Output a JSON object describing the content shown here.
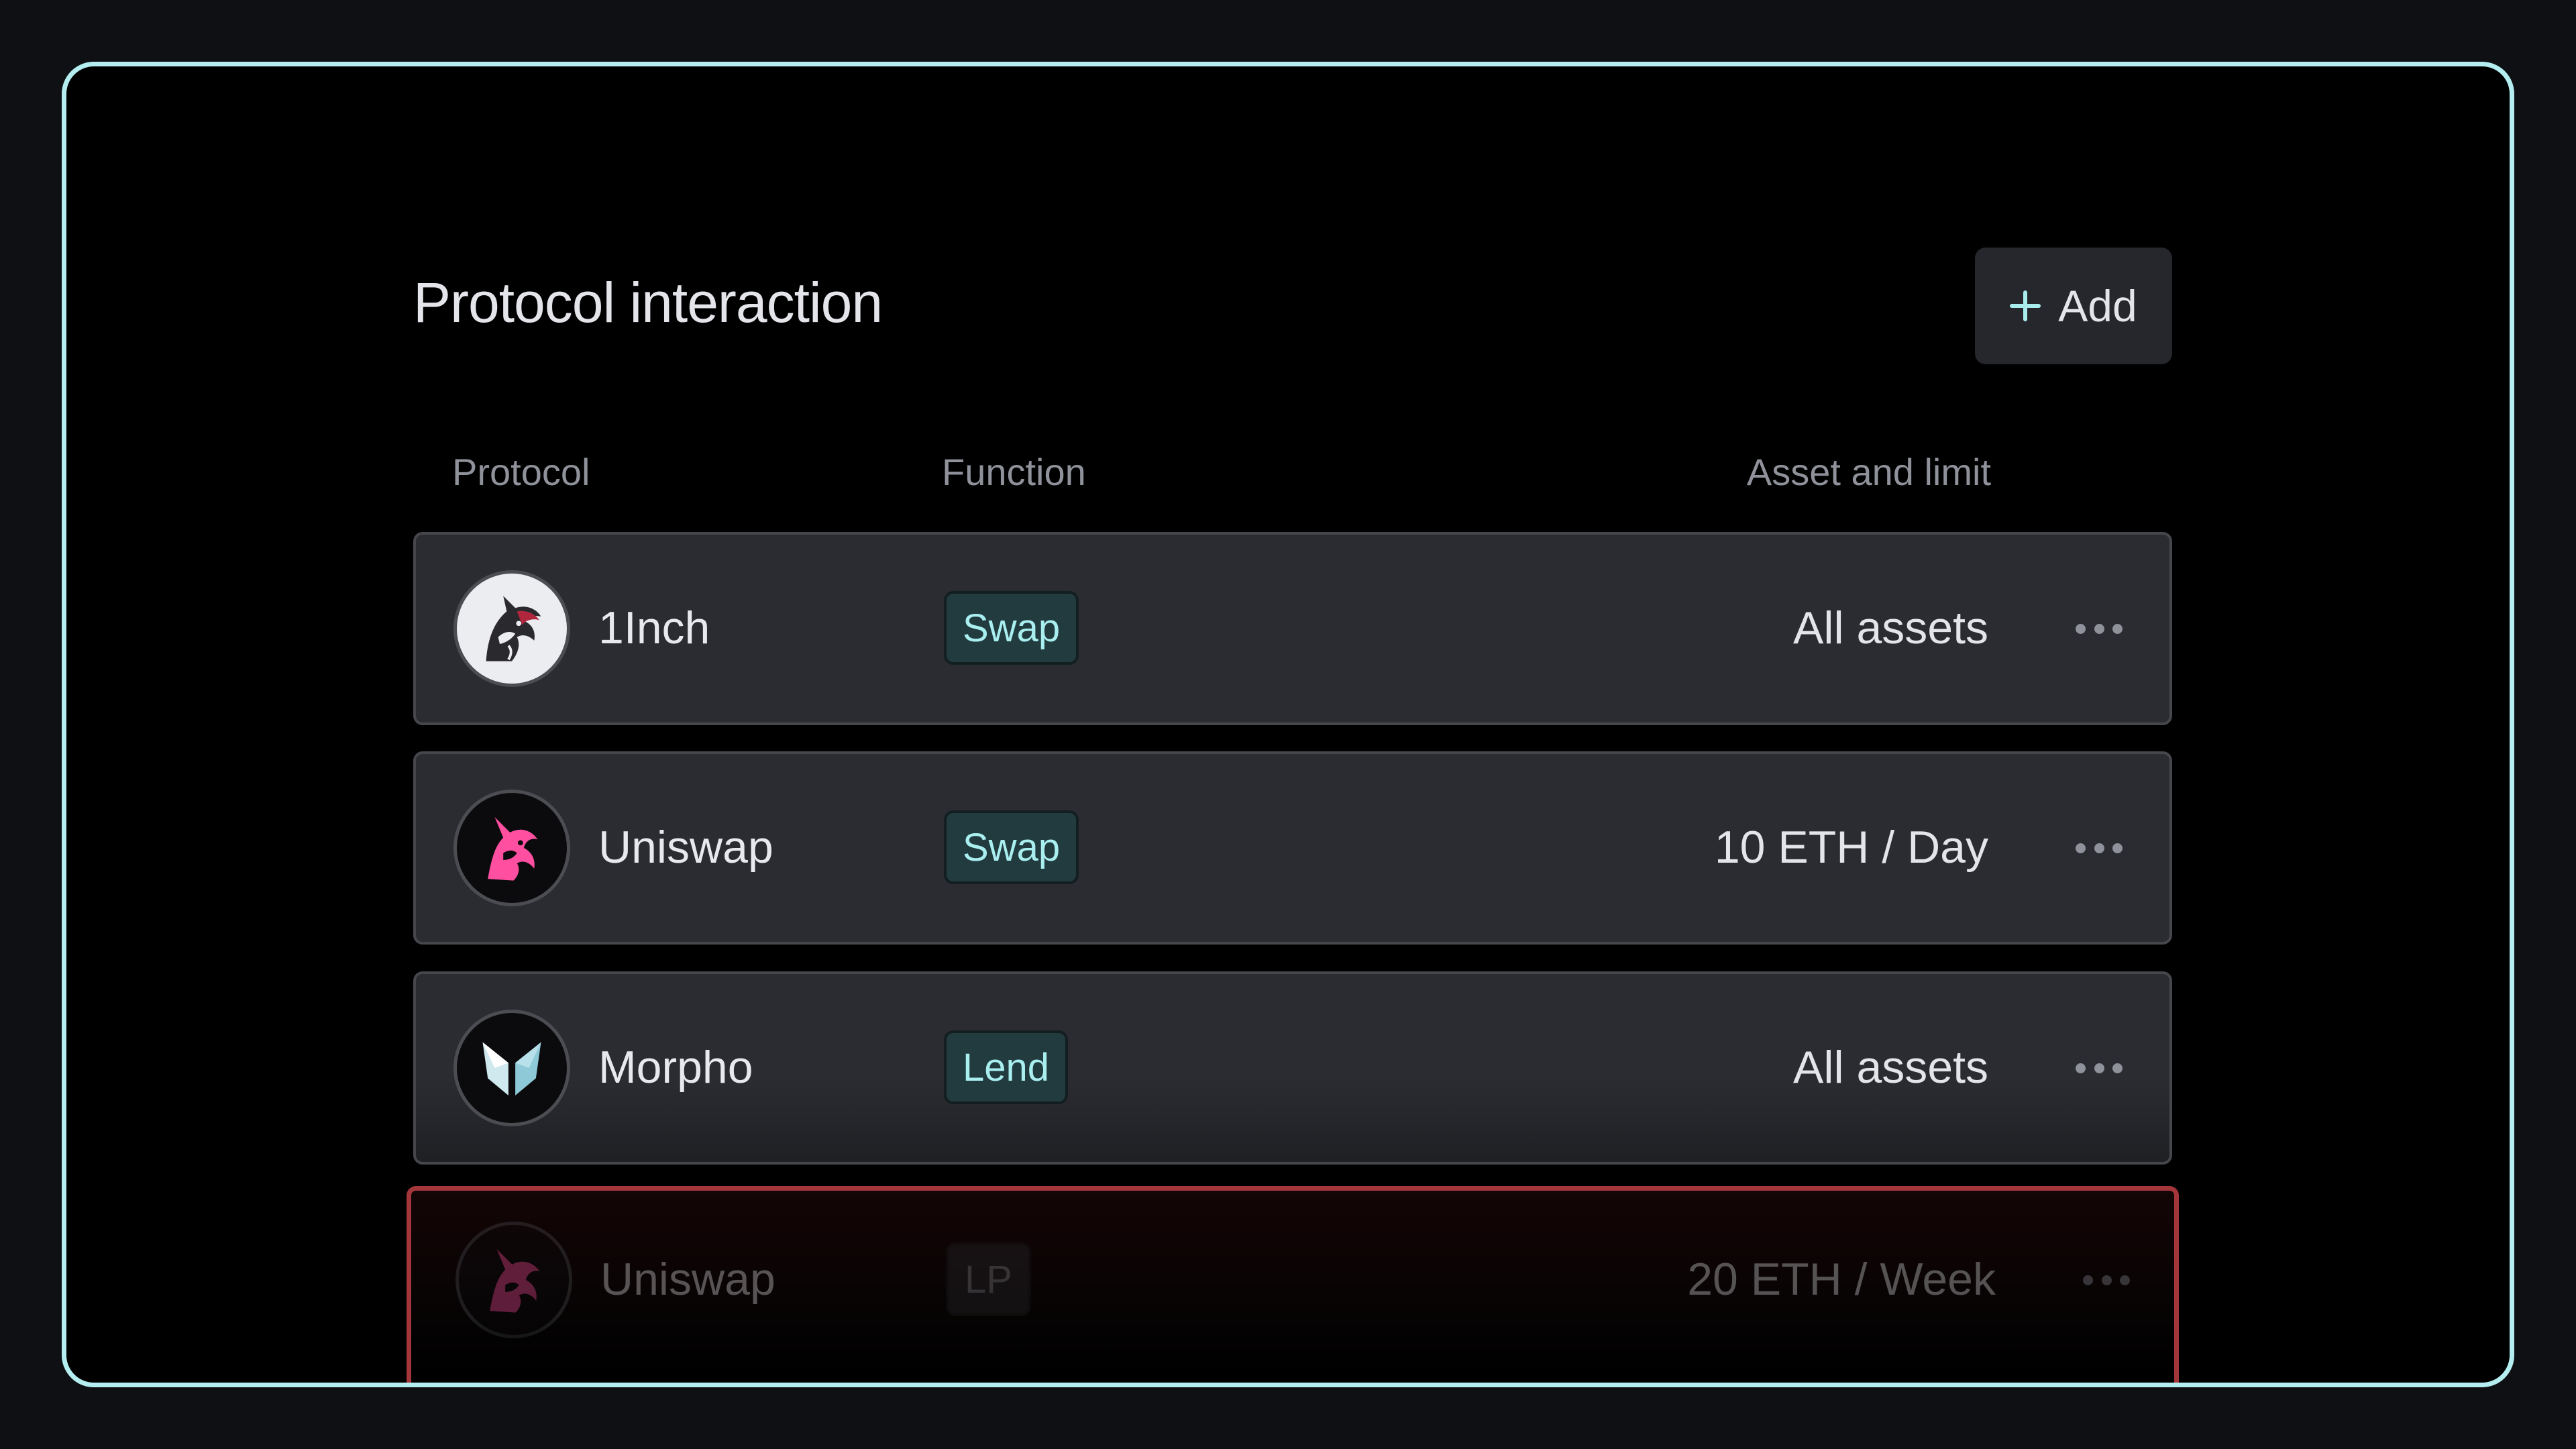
{
  "header": {
    "title": "Protocol interaction",
    "add_label": "Add"
  },
  "columns": {
    "protocol": "Protocol",
    "function": "Function",
    "asset": "Asset and limit"
  },
  "rows": [
    {
      "name": "1Inch",
      "function": "Swap",
      "asset": "All assets",
      "logo": "oneinch-unicorn-icon"
    },
    {
      "name": "Uniswap",
      "function": "Swap",
      "asset": "10 ETH / Day",
      "logo": "uniswap-unicorn-icon"
    },
    {
      "name": "Morpho",
      "function": "Lend",
      "asset": "All assets",
      "logo": "morpho-butterfly-icon"
    },
    {
      "name": "Uniswap",
      "function": "LP",
      "asset": "20 ETH / Week",
      "logo": "uniswap-unicorn-icon"
    }
  ],
  "colors": {
    "frame_border": "#b4eef0",
    "accent": "#a9eff0",
    "chip_bg": "#223b3f",
    "row_bg": "#2b2c31",
    "danger_border": "#a3363b",
    "uniswap_pink": "#ff4fa0"
  }
}
